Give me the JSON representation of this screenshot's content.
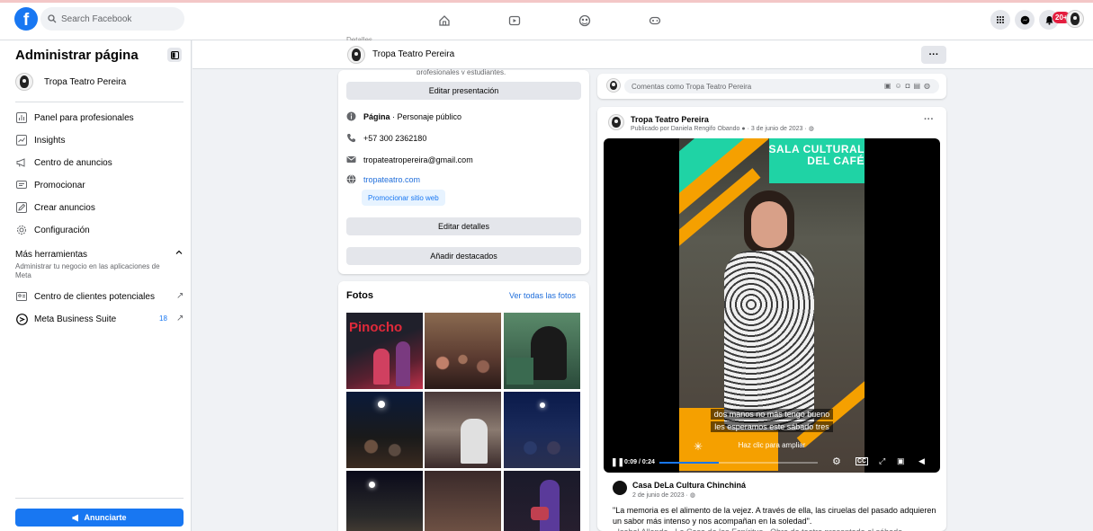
{
  "topnav": {
    "logo": "f",
    "search_placeholder": "Search Facebook",
    "notif_count": "20+"
  },
  "sidebar": {
    "title": "Administrar página",
    "page_name": "Tropa Teatro Pereira",
    "items": [
      {
        "label": "Panel para profesionales",
        "icon": "dashboard-icon"
      },
      {
        "label": "Insights",
        "icon": "insights-icon"
      },
      {
        "label": "Centro de anuncios",
        "icon": "megaphone-icon"
      },
      {
        "label": "Promocionar",
        "icon": "promote-icon"
      },
      {
        "label": "Crear anuncios",
        "icon": "pencil-icon"
      },
      {
        "label": "Configuración",
        "icon": "gear-icon"
      }
    ],
    "more_tools": "Más herramientas",
    "more_tools_sub": "Administrar tu negocio en las aplicaciones de Meta",
    "leads_center": "Centro de clientes potenciales",
    "meta_suite": "Meta Business Suite",
    "meta_suite_count": "18",
    "advertise_button": "Anunciarte"
  },
  "page_header": {
    "name": "Tropa Teatro Pereira",
    "more": "···"
  },
  "intro": {
    "cut_text": "profesionales y estudiantes.",
    "edit_presentation": "Editar presentación",
    "page_type_label": "Página",
    "page_type_value": " · Personaje público",
    "phone": "+57 300 2362180",
    "email": "tropateatropereira@gmail.com",
    "website": "tropateatro.com",
    "promote_website": "Promocionar sitio web",
    "edit_details": "Editar detalles",
    "add_featured": "Añadir destacados"
  },
  "photos": {
    "title": "Fotos",
    "see_all": "Ver todas las fotos",
    "first_photo_text": "Pinocho"
  },
  "comment": {
    "placeholder": "Comentas como Tropa Teatro Pereira"
  },
  "post": {
    "author": "Tropa Teatro Pereira",
    "published_by": "Publicado por Daniela Rengifo Obando",
    "date": "· 3 de junio de 2023 ·",
    "more": "···",
    "video": {
      "title_line1": "SALA CULTURAL",
      "title_line2": "DEL CAFÉ",
      "caption_line1": "dos manos no más tengo bueno",
      "caption_line2": "les esperamos este sábado tres",
      "enlarge_hint": "Haz clic para ampliar",
      "time": "0:09 / 0:24",
      "progress": 0.375
    },
    "shared_author": "Casa DeLa Cultura Chinchiná",
    "shared_date": "2 de junio de 2023 ·",
    "quote": "\"La memoria es el alimento de la vejez. A través de ella, las ciruelas del pasado adquieren un sabor más intenso y nos acompañan en la soledad\".",
    "quote_cont": "· Isabel Allende · La Casa de los Espíritus · Obra de teatro presentada el sábado."
  },
  "colors": {
    "brand_blue": "#1877f2",
    "video_orange": "#f5a000",
    "video_teal": "#1fd3a5"
  }
}
